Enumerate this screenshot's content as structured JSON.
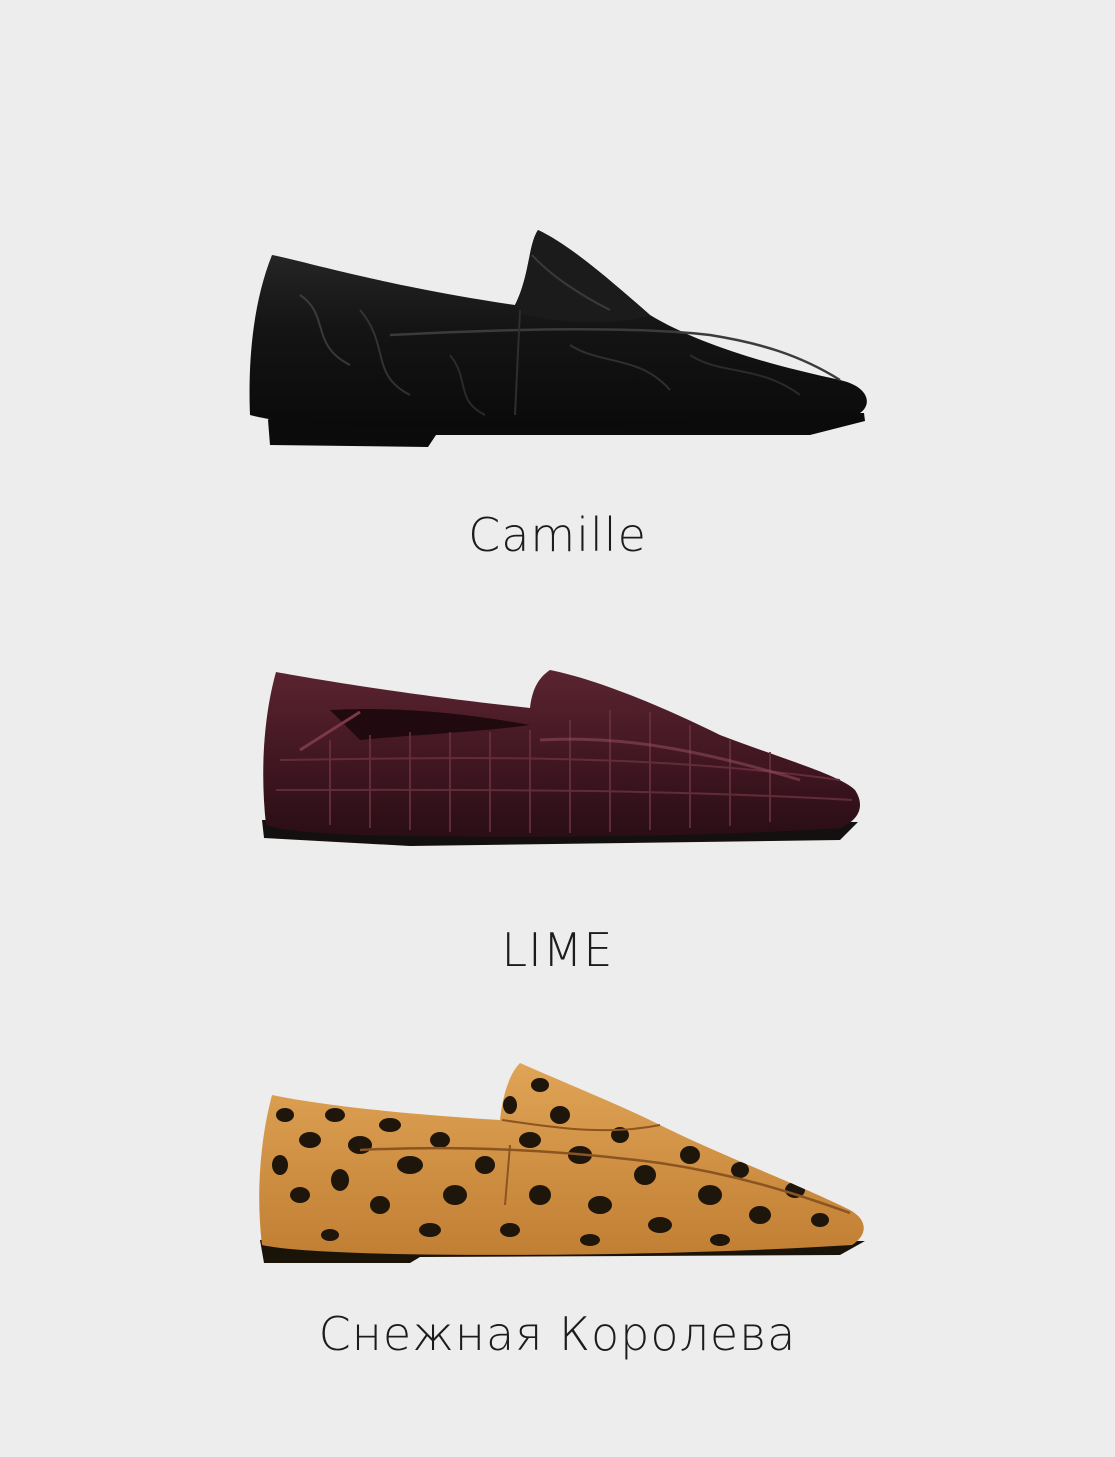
{
  "products": [
    {
      "name": "Camille",
      "color": "#161616"
    },
    {
      "name": "LIME",
      "color": "#4a1a22"
    },
    {
      "name": "Снежная Королева",
      "color": "#d79a45"
    }
  ]
}
